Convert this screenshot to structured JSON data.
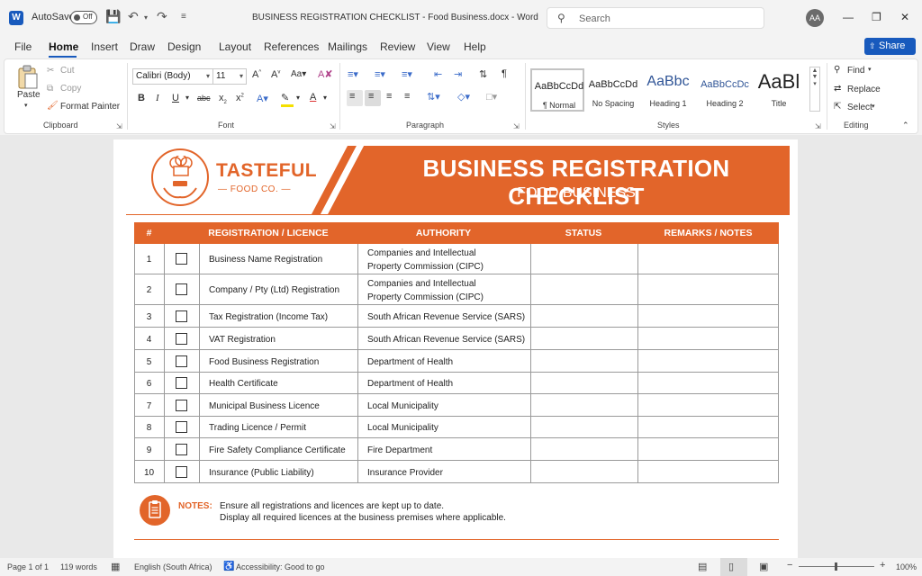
{
  "app": {
    "autosave_label": "AutoSave",
    "autosave_state": "Off",
    "doc_title": "BUSINESS REGISTRATION CHECKLIST - Food Business.docx - Word",
    "search_placeholder": "Search",
    "user_initials": "AA",
    "accent": "#185abd"
  },
  "menu": {
    "tabs": [
      "File",
      "Home",
      "Insert",
      "Draw",
      "Design",
      "Layout",
      "References",
      "Mailings",
      "Review",
      "View",
      "Help"
    ],
    "active_tab": "Home",
    "share_label": "Share"
  },
  "ribbon": {
    "clipboard": {
      "paste": "Paste",
      "cut": "Cut",
      "copy": "Copy",
      "format_painter": "Format Painter",
      "label": "Clipboard"
    },
    "font": {
      "font_name": "Calibri (Body)",
      "font_size": "11",
      "label": "Font"
    },
    "paragraph": {
      "label": "Paragraph"
    },
    "styles": {
      "label": "Styles",
      "items": [
        {
          "sample": "AaBbCcDd",
          "name": "¶ Normal"
        },
        {
          "sample": "AaBbCcDd",
          "name": "No Spacing"
        },
        {
          "sample": "AaBbc",
          "name": "Heading 1"
        },
        {
          "sample": "AaBbCcDc",
          "name": "Heading 2"
        },
        {
          "sample": "AaBl",
          "name": "Title"
        }
      ]
    },
    "editing": {
      "find": "Find",
      "replace": "Replace",
      "select": "Select",
      "label": "Editing"
    }
  },
  "document": {
    "logo_name": "TASTEFUL",
    "logo_sub": "— FOOD CO. —",
    "banner_title": "BUSINESS REGISTRATION CHECKLIST",
    "banner_subtitle": "FOOD BUSINESS",
    "brand_color": "#e2652a",
    "table": {
      "headers": [
        "#",
        "REGISTRATION / LICENCE",
        "AUTHORITY",
        "STATUS",
        "REMARKS / NOTES"
      ],
      "rows": [
        {
          "num": "1",
          "reg": "Business Name Registration",
          "auth1": "Companies and Intellectual",
          "auth2": "Property Commission (CIPC)"
        },
        {
          "num": "2",
          "reg": "Company / Pty (Ltd) Registration",
          "auth1": "Companies and Intellectual",
          "auth2": "Property Commission (CIPC)"
        },
        {
          "num": "3",
          "reg": "Tax Registration (Income Tax)",
          "auth1": "South African Revenue Service (SARS)",
          "auth2": ""
        },
        {
          "num": "4",
          "reg": "VAT Registration",
          "auth1": "South African Revenue Service (SARS)",
          "auth2": ""
        },
        {
          "num": "5",
          "reg": "Food Business Registration",
          "auth1": "Department of Health",
          "auth2": ""
        },
        {
          "num": "6",
          "reg": "Health Certificate",
          "auth1": "Department of Health",
          "auth2": ""
        },
        {
          "num": "7",
          "reg": "Municipal Business Licence",
          "auth1": "Local Municipality",
          "auth2": ""
        },
        {
          "num": "8",
          "reg": "Trading Licence / Permit",
          "auth1": "Local Municipality",
          "auth2": ""
        },
        {
          "num": "9",
          "reg": "Fire Safety Compliance Certificate",
          "auth1": "Fire Department",
          "auth2": ""
        },
        {
          "num": "10",
          "reg": "Insurance (Public Liability)",
          "auth1": "Insurance Provider",
          "auth2": ""
        }
      ]
    },
    "notes_label": "NOTES:",
    "notes": [
      "Ensure all registrations and licences are kept up to date.",
      "Display all required licences at the business premises where applicable."
    ]
  },
  "status": {
    "page": "Page 1 of 1",
    "words": "119 words",
    "language": "English (South Africa)",
    "accessibility": "Accessibility: Good to go",
    "zoom": "100%"
  }
}
